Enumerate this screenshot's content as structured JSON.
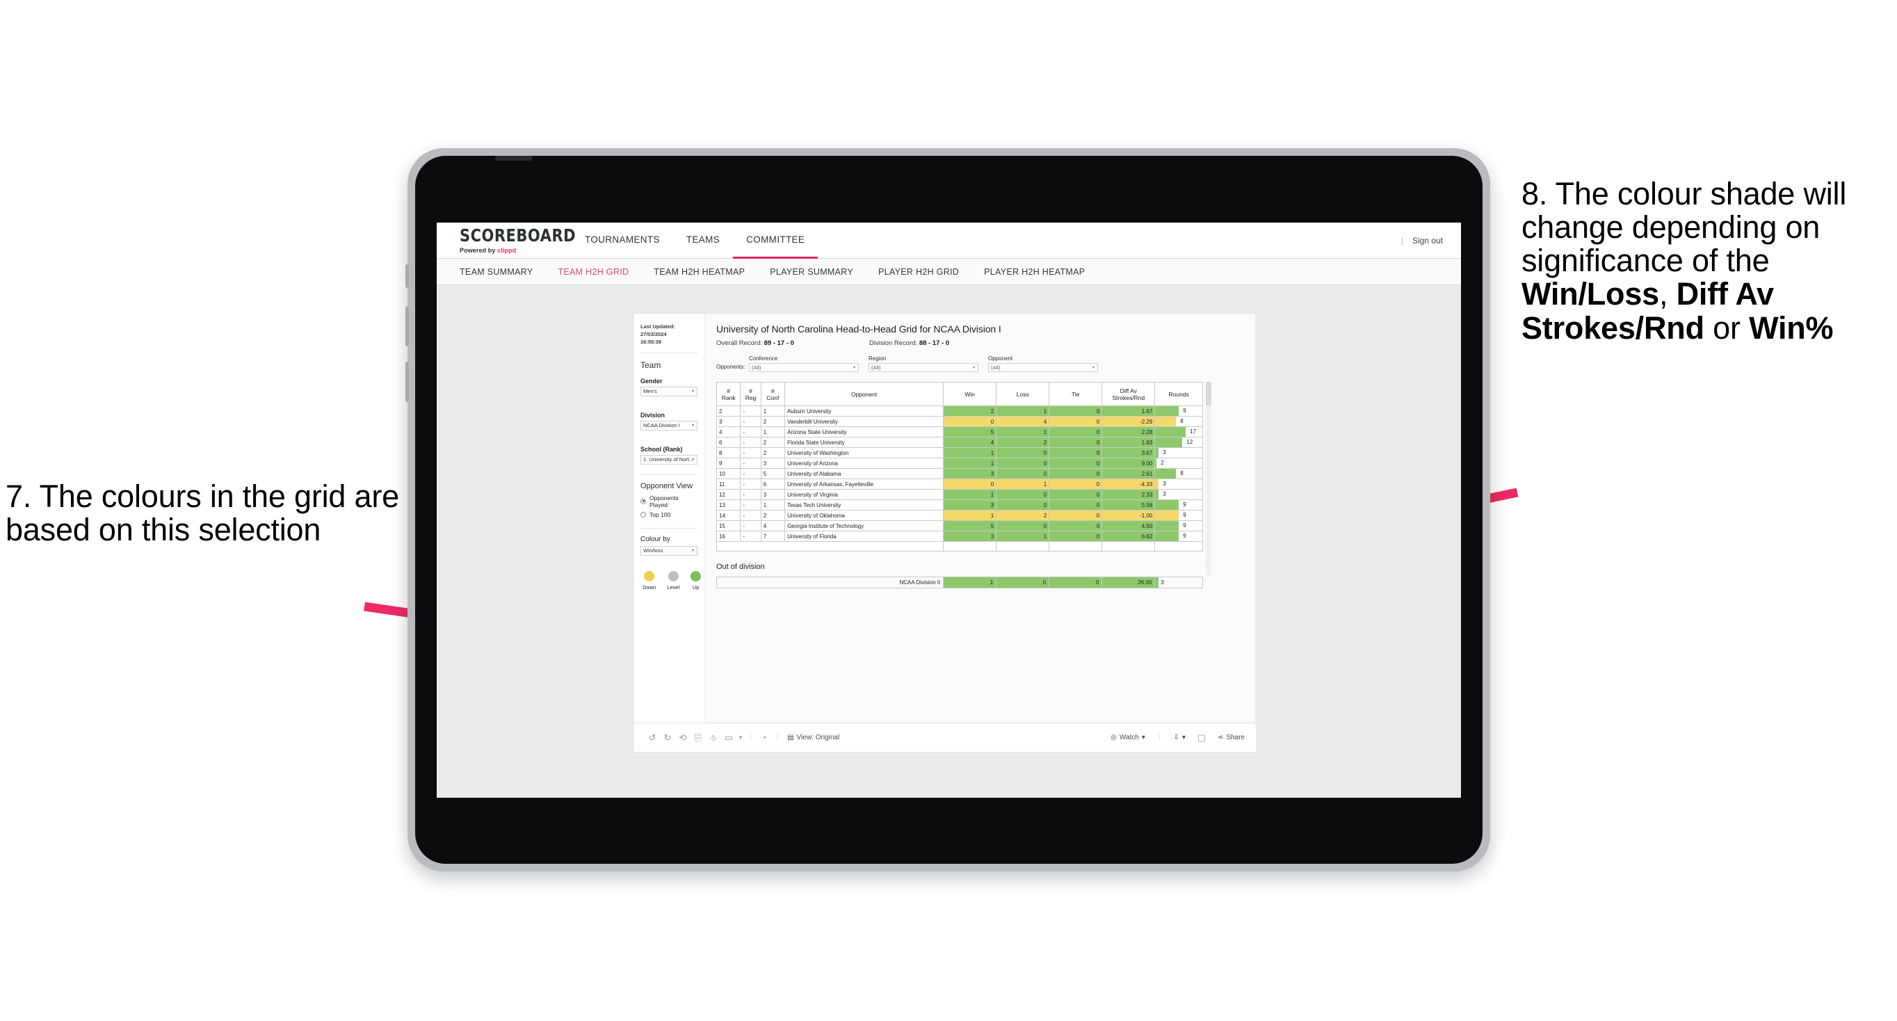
{
  "annotations": {
    "left": {
      "id": "7",
      "text": "7. The colours in the grid are based on this selection"
    },
    "right": {
      "id": "8",
      "line1": "8. The colour shade will change depending on significance of the ",
      "bold1": "Win/Loss",
      "mid1": ", ",
      "bold2": "Diff Av Strokes/Rnd",
      "mid2": " or ",
      "bold3": "Win%"
    }
  },
  "app": {
    "logo_main": "SCOREBOARD",
    "logo_sub_prefix": "Powered by ",
    "logo_sub_brand": "clippd",
    "nav": [
      {
        "label": "TOURNAMENTS",
        "active": false
      },
      {
        "label": "TEAMS",
        "active": false
      },
      {
        "label": "COMMITTEE",
        "active": true
      }
    ],
    "sign_out": "Sign out",
    "separator": "|",
    "subnav": [
      {
        "label": "TEAM SUMMARY",
        "active": false
      },
      {
        "label": "TEAM H2H GRID",
        "active": true
      },
      {
        "label": "TEAM H2H HEATMAP",
        "active": false
      },
      {
        "label": "PLAYER SUMMARY",
        "active": false
      },
      {
        "label": "PLAYER H2H GRID",
        "active": false
      },
      {
        "label": "PLAYER H2H HEATMAP",
        "active": false
      }
    ]
  },
  "panel": {
    "last_updated_label": "Last Updated: 27/03/2024",
    "last_updated_time": "16:55:38",
    "team_heading": "Team",
    "gender_label": "Gender",
    "gender_value": "Men's",
    "division_label": "Division",
    "division_value": "NCAA Division I",
    "school_label": "School (Rank)",
    "school_value": "1. University of Nort...",
    "opponent_view_heading": "Opponent View",
    "radio_options": [
      {
        "label": "Opponents Played",
        "selected": true
      },
      {
        "label": "Top 100",
        "selected": false
      }
    ],
    "colour_by_label": "Colour by",
    "colour_by_value": "Win/loss",
    "legend": [
      {
        "label": "Down",
        "color": "#f2cf52"
      },
      {
        "label": "Level",
        "color": "#bfc0c4"
      },
      {
        "label": "Up",
        "color": "#7dc05a"
      }
    ]
  },
  "main": {
    "title": "University of North Carolina Head-to-Head Grid for NCAA Division I",
    "overall_label": "Overall Record: ",
    "overall_value": "89 - 17 - 0",
    "division_label": "Division Record: ",
    "division_value": "88 - 17 - 0",
    "opponents_label": "Opponents:",
    "filters": [
      {
        "label": "Conference",
        "value": "(All)"
      },
      {
        "label": "Region",
        "value": "(All)"
      },
      {
        "label": "Opponent",
        "value": "(All)"
      }
    ],
    "columns": [
      {
        "l1": "#",
        "l2": "Rank"
      },
      {
        "l1": "#",
        "l2": "Reg"
      },
      {
        "l1": "#",
        "l2": "Conf"
      },
      {
        "l1": "Opponent",
        "l2": ""
      },
      {
        "l1": "Win",
        "l2": ""
      },
      {
        "l1": "Loss",
        "l2": ""
      },
      {
        "l1": "Tie",
        "l2": ""
      },
      {
        "l1": "Diff Av",
        "l2": "Strokes/Rnd"
      },
      {
        "l1": "Rounds",
        "l2": ""
      }
    ],
    "rows": [
      {
        "rank": "2",
        "reg": "-",
        "conf": "1",
        "opponent": "Auburn University",
        "win": "2",
        "loss": "1",
        "tie": "0",
        "diff": "1.67",
        "rounds": "9",
        "bar": 34,
        "color": "#8dc96a"
      },
      {
        "rank": "3",
        "reg": "-",
        "conf": "2",
        "opponent": "Vanderbilt University",
        "win": "0",
        "loss": "4",
        "tie": "0",
        "diff": "-2.29",
        "rounds": "8",
        "bar": 30,
        "color": "#f5d86a"
      },
      {
        "rank": "4",
        "reg": "-",
        "conf": "1",
        "opponent": "Arizona State University",
        "win": "5",
        "loss": "1",
        "tie": "0",
        "diff": "2.28",
        "rounds": "17",
        "bar": 44,
        "color": "#8dc96a"
      },
      {
        "rank": "6",
        "reg": "-",
        "conf": "2",
        "opponent": "Florida State University",
        "win": "4",
        "loss": "2",
        "tie": "0",
        "diff": "1.83",
        "rounds": "12",
        "bar": 39,
        "color": "#8dc96a"
      },
      {
        "rank": "8",
        "reg": "-",
        "conf": "2",
        "opponent": "University of Washington",
        "win": "1",
        "loss": "0",
        "tie": "0",
        "diff": "3.67",
        "rounds": "3",
        "bar": 5,
        "color": "#8dc96a"
      },
      {
        "rank": "9",
        "reg": "-",
        "conf": "3",
        "opponent": "University of Arizona",
        "win": "1",
        "loss": "0",
        "tie": "0",
        "diff": "9.00",
        "rounds": "2",
        "bar": 2,
        "color": "#8dc96a"
      },
      {
        "rank": "10",
        "reg": "-",
        "conf": "5",
        "opponent": "University of Alabama",
        "win": "3",
        "loss": "0",
        "tie": "0",
        "diff": "2.61",
        "rounds": "8",
        "bar": 30,
        "color": "#8dc96a"
      },
      {
        "rank": "11",
        "reg": "-",
        "conf": "6",
        "opponent": "University of Arkansas, Fayetteville",
        "win": "0",
        "loss": "1",
        "tie": "0",
        "diff": "-4.33",
        "rounds": "3",
        "bar": 5,
        "color": "#f5d86a"
      },
      {
        "rank": "12",
        "reg": "-",
        "conf": "3",
        "opponent": "University of Virginia",
        "win": "1",
        "loss": "0",
        "tie": "0",
        "diff": "2.33",
        "rounds": "3",
        "bar": 5,
        "color": "#8dc96a"
      },
      {
        "rank": "13",
        "reg": "-",
        "conf": "1",
        "opponent": "Texas Tech University",
        "win": "3",
        "loss": "0",
        "tie": "0",
        "diff": "5.56",
        "rounds": "9",
        "bar": 34,
        "color": "#8dc96a"
      },
      {
        "rank": "14",
        "reg": "-",
        "conf": "2",
        "opponent": "University of Oklahoma",
        "win": "1",
        "loss": "2",
        "tie": "0",
        "diff": "-1.00",
        "rounds": "9",
        "bar": 34,
        "color": "#f5d86a"
      },
      {
        "rank": "15",
        "reg": "-",
        "conf": "4",
        "opponent": "Georgia Institute of Technology",
        "win": "5",
        "loss": "0",
        "tie": "0",
        "diff": "4.50",
        "rounds": "9",
        "bar": 34,
        "color": "#8dc96a"
      },
      {
        "rank": "16",
        "reg": "-",
        "conf": "7",
        "opponent": "University of Florida",
        "win": "3",
        "loss": "1",
        "tie": "0",
        "diff": "6.62",
        "rounds": "9",
        "bar": 34,
        "color": "#8dc96a"
      }
    ],
    "out_of_division_title": "Out of division",
    "out_of_division_row": {
      "label": "NCAA Division II",
      "win": "1",
      "loss": "0",
      "tie": "0",
      "diff": "26.00",
      "rounds": "3",
      "bar": 5,
      "color": "#8dc96a"
    }
  },
  "toolbar": {
    "view_label": "View: Original",
    "watch_label": "Watch",
    "share_label": "Share",
    "caret": "▾"
  },
  "chart_data": {
    "type": "table",
    "title": "University of North Carolina Head-to-Head Grid for NCAA Division I",
    "columns": [
      "# Rank",
      "# Reg",
      "# Conf",
      "Opponent",
      "Win",
      "Loss",
      "Tie",
      "Diff Av Strokes/Rnd",
      "Rounds"
    ],
    "rows": [
      [
        "2",
        "-",
        "1",
        "Auburn University",
        2,
        1,
        0,
        1.67,
        9
      ],
      [
        "3",
        "-",
        "2",
        "Vanderbilt University",
        0,
        4,
        0,
        -2.29,
        8
      ],
      [
        "4",
        "-",
        "1",
        "Arizona State University",
        5,
        1,
        0,
        2.28,
        17
      ],
      [
        "6",
        "-",
        "2",
        "Florida State University",
        4,
        2,
        0,
        1.83,
        12
      ],
      [
        "8",
        "-",
        "2",
        "University of Washington",
        1,
        0,
        0,
        3.67,
        3
      ],
      [
        "9",
        "-",
        "3",
        "University of Arizona",
        1,
        0,
        0,
        9.0,
        2
      ],
      [
        "10",
        "-",
        "5",
        "University of Alabama",
        3,
        0,
        0,
        2.61,
        8
      ],
      [
        "11",
        "-",
        "6",
        "University of Arkansas, Fayetteville",
        0,
        1,
        0,
        -4.33,
        3
      ],
      [
        "12",
        "-",
        "3",
        "University of Virginia",
        1,
        0,
        0,
        2.33,
        3
      ],
      [
        "13",
        "-",
        "1",
        "Texas Tech University",
        3,
        0,
        0,
        5.56,
        9
      ],
      [
        "14",
        "-",
        "2",
        "University of Oklahoma",
        1,
        2,
        0,
        -1.0,
        9
      ],
      [
        "15",
        "-",
        "4",
        "Georgia Institute of Technology",
        5,
        0,
        0,
        4.5,
        9
      ],
      [
        "16",
        "-",
        "7",
        "University of Florida",
        3,
        1,
        0,
        6.62,
        9
      ]
    ],
    "out_of_division": [
      [
        "NCAA Division II",
        1,
        0,
        0,
        26.0,
        3
      ]
    ],
    "colour_by": "Win/loss",
    "legend": [
      "Down",
      "Level",
      "Up"
    ],
    "legend_colors": [
      "#f2cf52",
      "#bfc0c4",
      "#7dc05a"
    ]
  }
}
